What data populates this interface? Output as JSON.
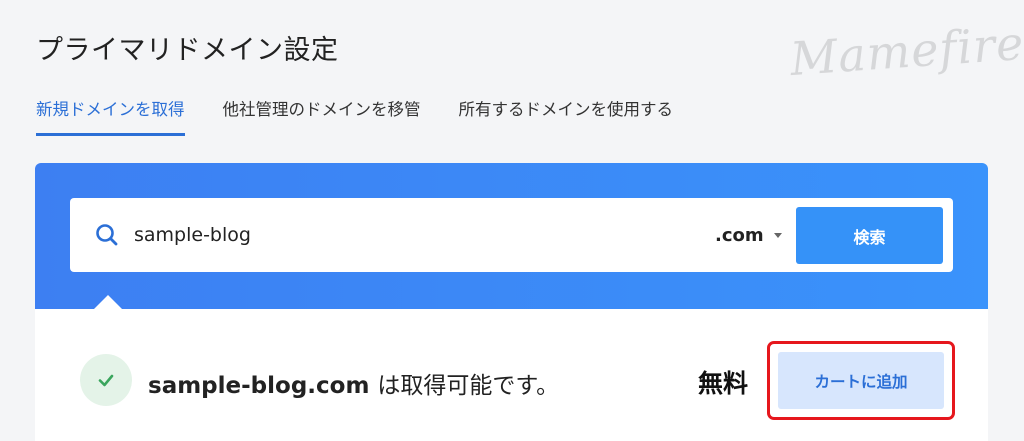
{
  "page": {
    "title": "プライマリドメイン設定",
    "watermark": "Mamefire"
  },
  "tabs": [
    {
      "label": "新規ドメインを取得",
      "active": true
    },
    {
      "label": "他社管理のドメインを移管",
      "active": false
    },
    {
      "label": "所有するドメインを使用する",
      "active": false
    }
  ],
  "search": {
    "value": "sample-blog",
    "tld": ".com",
    "button_label": "検索",
    "icon": "search-icon"
  },
  "result": {
    "domain": "sample-blog.com",
    "message": "は取得可能です。",
    "price": "無料",
    "cart_button_label": "カートに追加",
    "status_icon": "check-icon"
  },
  "colors": {
    "accent": "#2b6fd6",
    "panel_gradient_start": "#3d7ff2",
    "panel_gradient_end": "#3a93fb",
    "success": "#3aa55d",
    "highlight": "#e6171d"
  }
}
